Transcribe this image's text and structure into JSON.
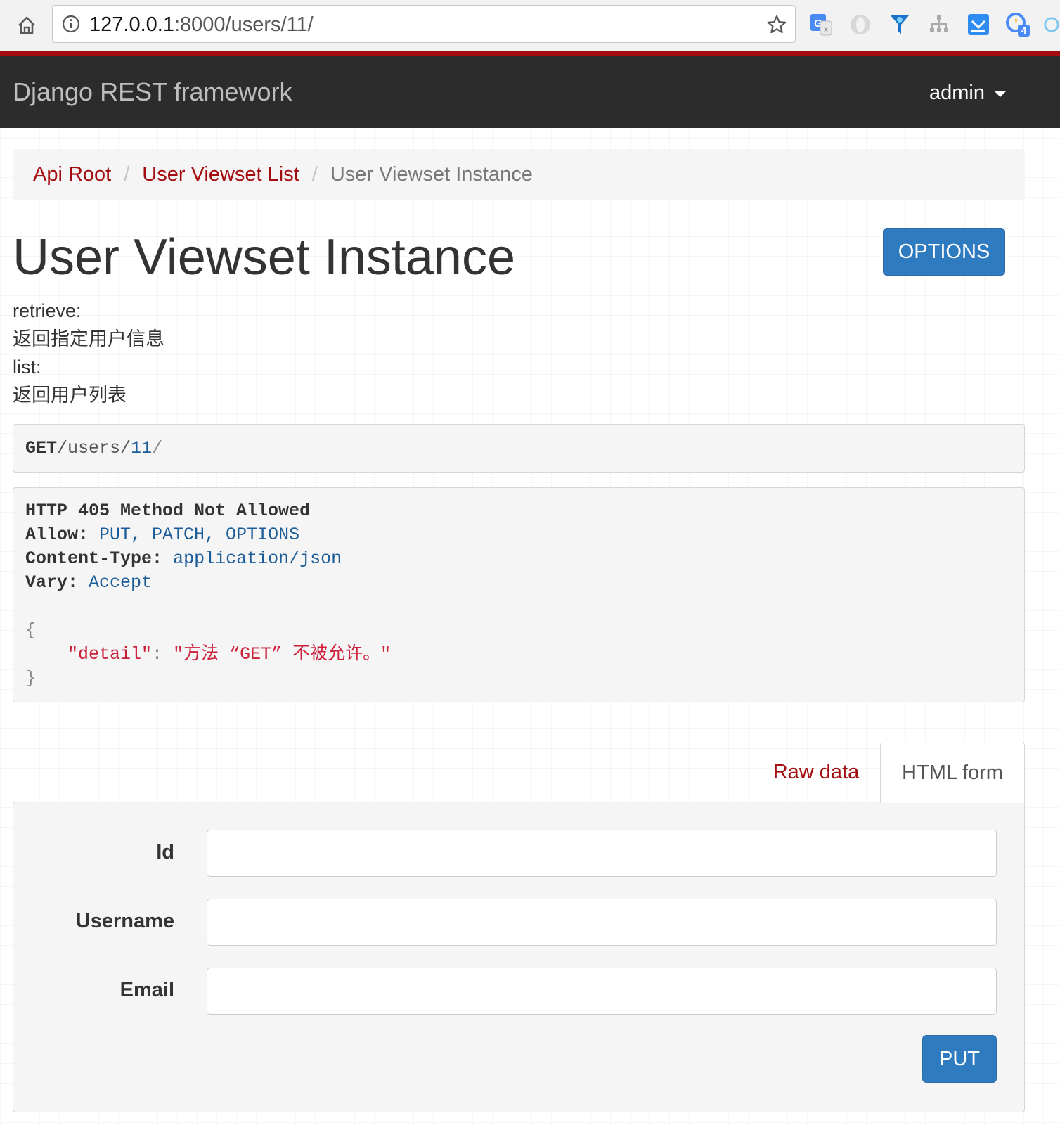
{
  "browser": {
    "url_host": "127.0.0.1",
    "url_rest": ":8000/users/11/",
    "extensions": [
      "google-translate-icon",
      "opera-icon",
      "funnel-icon",
      "sitemap-icon",
      "pocket-icon",
      "badge-extension-icon",
      "partial-extension-icon"
    ],
    "badge_count": "4"
  },
  "navbar": {
    "brand": "Django REST framework",
    "user": "admin"
  },
  "breadcrumb": {
    "items": [
      "Api Root",
      "User Viewset List"
    ],
    "active": "User Viewset Instance"
  },
  "page": {
    "title": "User Viewset Instance",
    "options_label": "OPTIONS",
    "description": [
      "retrieve:",
      "返回指定用户信息",
      "list:",
      "返回用户列表"
    ]
  },
  "request": {
    "method": "GET",
    "path_prefix": "/users/",
    "path_id": "11",
    "path_suffix": "/"
  },
  "response": {
    "status_line": "HTTP 405 Method Not Allowed",
    "headers": [
      {
        "key": "Allow:",
        "value": "PUT, PATCH, OPTIONS"
      },
      {
        "key": "Content-Type:",
        "value": "application/json"
      },
      {
        "key": "Vary:",
        "value": "Accept"
      }
    ],
    "body_open": "{",
    "body_key": "\"detail\"",
    "body_colon": ":",
    "body_value": "\"方法 “GET” 不被允许。\"",
    "body_close": "}"
  },
  "tabs": {
    "raw": "Raw data",
    "html": "HTML form"
  },
  "form": {
    "fields": [
      {
        "label": "Id",
        "value": ""
      },
      {
        "label": "Username",
        "value": ""
      },
      {
        "label": "Email",
        "value": ""
      }
    ],
    "submit_label": "PUT"
  },
  "colors": {
    "accent_red": "#a30d10",
    "navbar_bg": "#2c2c2c",
    "button_blue": "#2f7bbf"
  }
}
